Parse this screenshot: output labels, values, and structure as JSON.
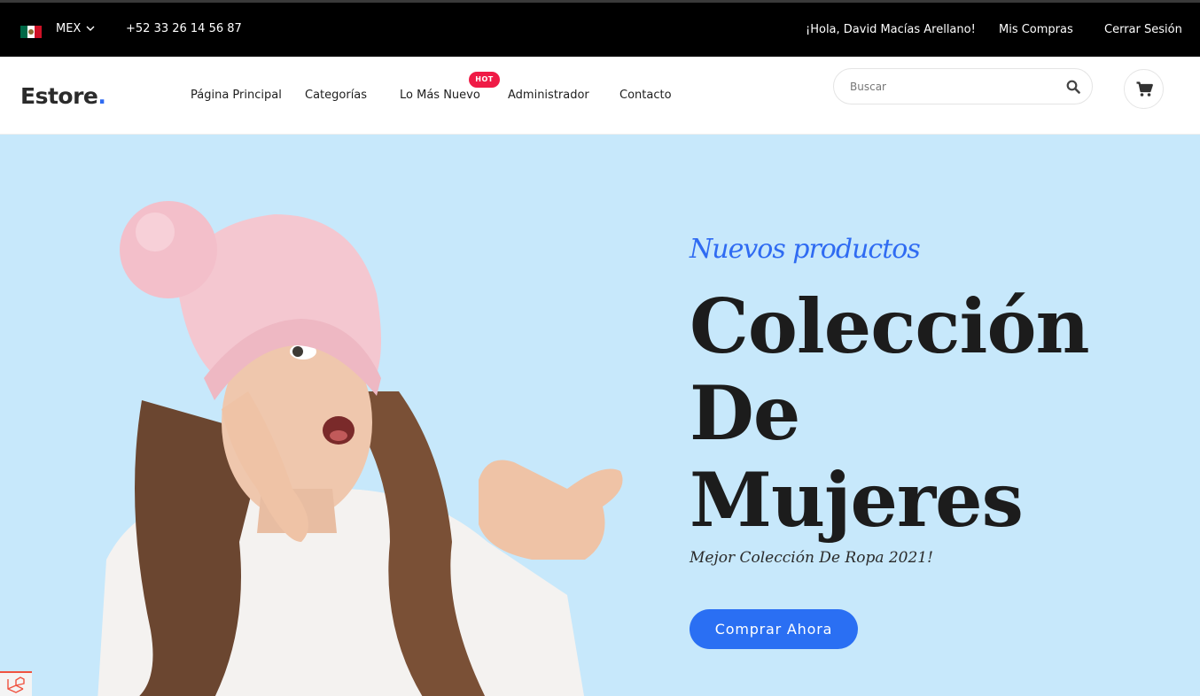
{
  "topbar": {
    "country_code": "MEX",
    "phone": "+52 33 26 14 56 87",
    "greeting": "¡Hola, David Macías Arellano!",
    "my_purchases": "Mis Compras",
    "logout": "Cerrar Sesión"
  },
  "header": {
    "logo_text": "Estore",
    "logo_dot": ".",
    "nav": {
      "home": "Página Principal",
      "categories": "Categorías",
      "newest": "Lo Más Nuevo",
      "admin": "Administrador",
      "contact": "Contacto"
    },
    "hot_badge": "HOT",
    "search_placeholder": "Buscar"
  },
  "hero": {
    "tagline": "Nuevos productos",
    "headline_line1": "Colección",
    "headline_line2": "De",
    "headline_line3": "Mujeres",
    "subtitle": "Mejor Colección De Ropa 2021!",
    "cta": "Comprar Ahora"
  },
  "colors": {
    "accent": "#2f6bf2",
    "hero_bg": "#c7e8fb",
    "hot": "#ef1b46",
    "topbar_bg": "#000000"
  },
  "icons": [
    "mexico-flag-icon",
    "chevron-down-icon",
    "search-icon",
    "cart-icon",
    "laravel-icon"
  ]
}
